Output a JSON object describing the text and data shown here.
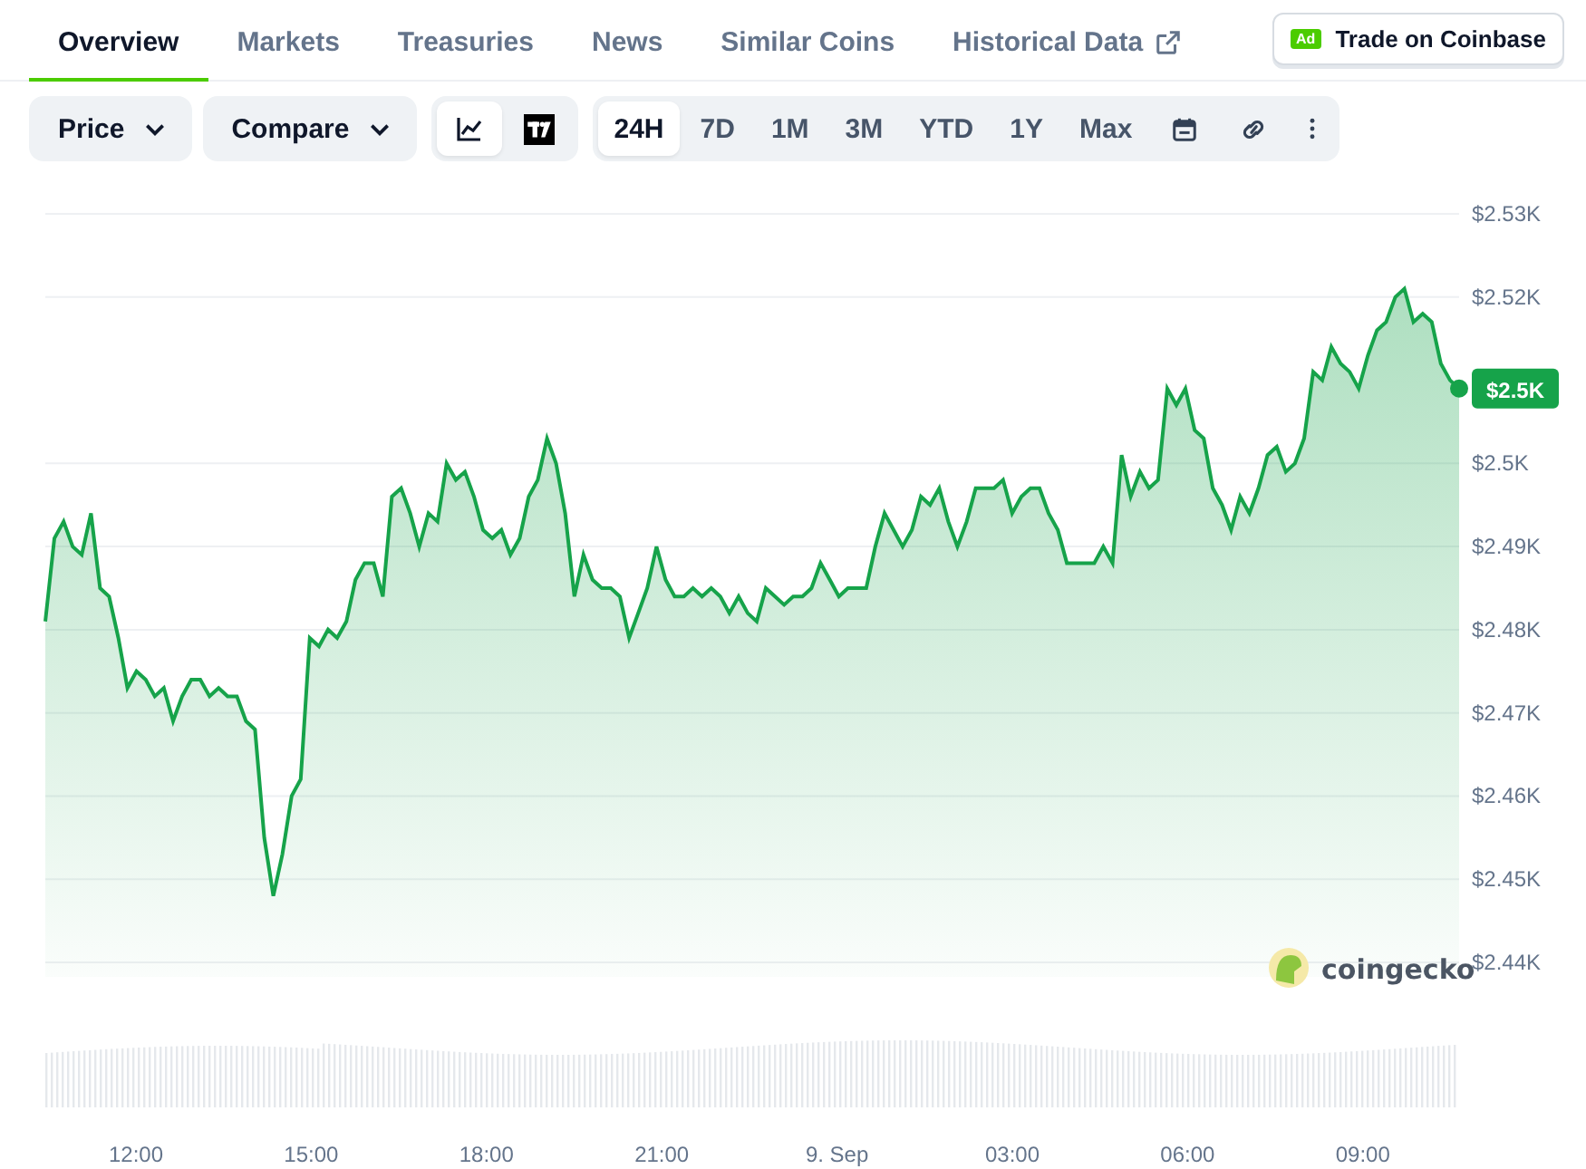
{
  "tabs": [
    {
      "label": "Overview",
      "selected": true,
      "external": false
    },
    {
      "label": "Markets",
      "selected": false,
      "external": false
    },
    {
      "label": "Treasuries",
      "selected": false,
      "external": false
    },
    {
      "label": "News",
      "selected": false,
      "external": false
    },
    {
      "label": "Similar Coins",
      "selected": false,
      "external": false
    },
    {
      "label": "Historical Data",
      "selected": false,
      "external": true
    }
  ],
  "sponsor_button": {
    "badge": "Ad",
    "label": "Trade on Coinbase"
  },
  "toolbar": {
    "dropdowns": [
      "Price",
      "Compare"
    ],
    "chart_types": [
      {
        "kind": "line",
        "selected": true
      },
      {
        "kind": "tradingview",
        "selected": false
      }
    ],
    "ranges": [
      {
        "label": "24H",
        "selected": true
      },
      {
        "label": "7D",
        "selected": false
      },
      {
        "label": "1M",
        "selected": false
      },
      {
        "label": "3M",
        "selected": false
      },
      {
        "label": "YTD",
        "selected": false
      },
      {
        "label": "1Y",
        "selected": false
      },
      {
        "label": "Max",
        "selected": false
      }
    ],
    "tools": [
      {
        "kind": "calendar"
      },
      {
        "kind": "link"
      },
      {
        "kind": "more"
      }
    ]
  },
  "chart": {
    "price_badge": "$2.5K",
    "brand": "coingecko",
    "x_axis_labels": [
      "12:00",
      "15:00",
      "18:00",
      "21:00",
      "9. Sep",
      "03:00",
      "06:00",
      "09:00"
    ],
    "chart_data": {
      "type": "area",
      "grid": true,
      "ylim": [
        2440,
        2530
      ],
      "yticks": [
        {
          "value": 2440,
          "label": "$2.44K"
        },
        {
          "value": 2450,
          "label": "$2.45K"
        },
        {
          "value": 2460,
          "label": "$2.46K"
        },
        {
          "value": 2470,
          "label": "$2.47K"
        },
        {
          "value": 2480,
          "label": "$2.48K"
        },
        {
          "value": 2490,
          "label": "$2.49K"
        },
        {
          "value": 2500,
          "label": "$2.5K"
        },
        {
          "value": 2520,
          "label": "$2.52K"
        },
        {
          "value": 2530,
          "label": "$2.53K"
        }
      ],
      "series": [
        {
          "color": "#16a34a",
          "values": [
            2481,
            2491,
            2493,
            2490,
            2489,
            2494,
            2485,
            2484,
            2479,
            2473,
            2475,
            2474,
            2472,
            2473,
            2469,
            2472,
            2474,
            2474,
            2472,
            2473,
            2472,
            2472,
            2469,
            2468,
            2455,
            2448,
            2453,
            2460,
            2462,
            2479,
            2478,
            2480,
            2479,
            2481,
            2486,
            2488,
            2488,
            2484,
            2496,
            2497,
            2494,
            2490,
            2494,
            2493,
            2500,
            2498,
            2499,
            2496,
            2492,
            2491,
            2492,
            2489,
            2491,
            2496,
            2498,
            2503,
            2500,
            2494,
            2484,
            2489,
            2486,
            2485,
            2485,
            2484,
            2479,
            2482,
            2485,
            2490,
            2486,
            2484,
            2484,
            2485,
            2484,
            2485,
            2484,
            2482,
            2484,
            2482,
            2481,
            2485,
            2484,
            2483,
            2484,
            2484,
            2485,
            2488,
            2486,
            2484,
            2485,
            2485,
            2485,
            2490,
            2494,
            2492,
            2490,
            2492,
            2496,
            2495,
            2497,
            2493,
            2490,
            2493,
            2497,
            2497,
            2497,
            2498,
            2494,
            2496,
            2497,
            2497,
            2494,
            2492,
            2488,
            2488,
            2488,
            2488,
            2490,
            2488,
            2501,
            2496,
            2499,
            2497,
            2498,
            2509,
            2507,
            2509,
            2504,
            2503,
            2497,
            2495,
            2492,
            2496,
            2494,
            2497,
            2501,
            2502,
            2499,
            2500,
            2503,
            2511,
            2510,
            2514,
            2512,
            2511,
            2509,
            2513,
            2516,
            2517,
            2520,
            2521,
            2517,
            2518,
            2517,
            2512,
            2510,
            2509
          ]
        }
      ]
    }
  }
}
